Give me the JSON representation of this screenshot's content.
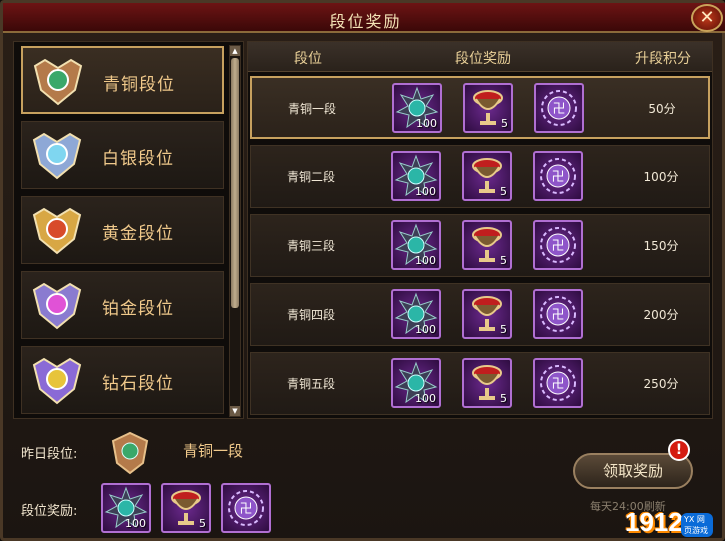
{
  "window": {
    "title": "段位奖励",
    "close_icon": "close-icon"
  },
  "ranks": [
    {
      "label": "青铜段位",
      "icon": "bronze-medal-icon",
      "color": "#b47a4a",
      "gem": "#3aa86a"
    },
    {
      "label": "白银段位",
      "icon": "silver-medal-icon",
      "color": "#8ea8d6",
      "gem": "#7fd6f0"
    },
    {
      "label": "黄金段位",
      "icon": "gold-medal-icon",
      "color": "#d8a744",
      "gem": "#d84b2a"
    },
    {
      "label": "铂金段位",
      "icon": "platinum-medal-icon",
      "color": "#8a7bd0",
      "gem": "#e052d6"
    },
    {
      "label": "钻石段位",
      "icon": "diamond-medal-icon",
      "color": "#8a6ad6",
      "gem": "#e7c43a"
    }
  ],
  "table": {
    "headers": [
      "段位",
      "段位奖励",
      "升段积分"
    ],
    "rows": [
      {
        "name": "青铜一段",
        "points": "50分",
        "rewards": [
          "100",
          "5",
          ""
        ]
      },
      {
        "name": "青铜二段",
        "points": "100分",
        "rewards": [
          "100",
          "5",
          ""
        ]
      },
      {
        "name": "青铜三段",
        "points": "150分",
        "rewards": [
          "100",
          "5",
          ""
        ]
      },
      {
        "name": "青铜四段",
        "points": "200分",
        "rewards": [
          "100",
          "5",
          ""
        ]
      },
      {
        "name": "青铜五段",
        "points": "250分",
        "rewards": [
          "100",
          "5",
          ""
        ]
      }
    ]
  },
  "reward_icons": [
    "gem-orb-icon",
    "goblet-icon",
    "rune-sigil-icon"
  ],
  "bottom": {
    "yesterday_label": "昨日段位:",
    "yesterday_rank": "青铜一段",
    "rewards_label": "段位奖励:",
    "rewards": [
      "100",
      "5",
      ""
    ],
    "claim_button": "领取奖励",
    "alert": "!",
    "note": "每天24:00刷新",
    "logo_text": "1912",
    "logo_badge": "YX 网页游戏"
  }
}
